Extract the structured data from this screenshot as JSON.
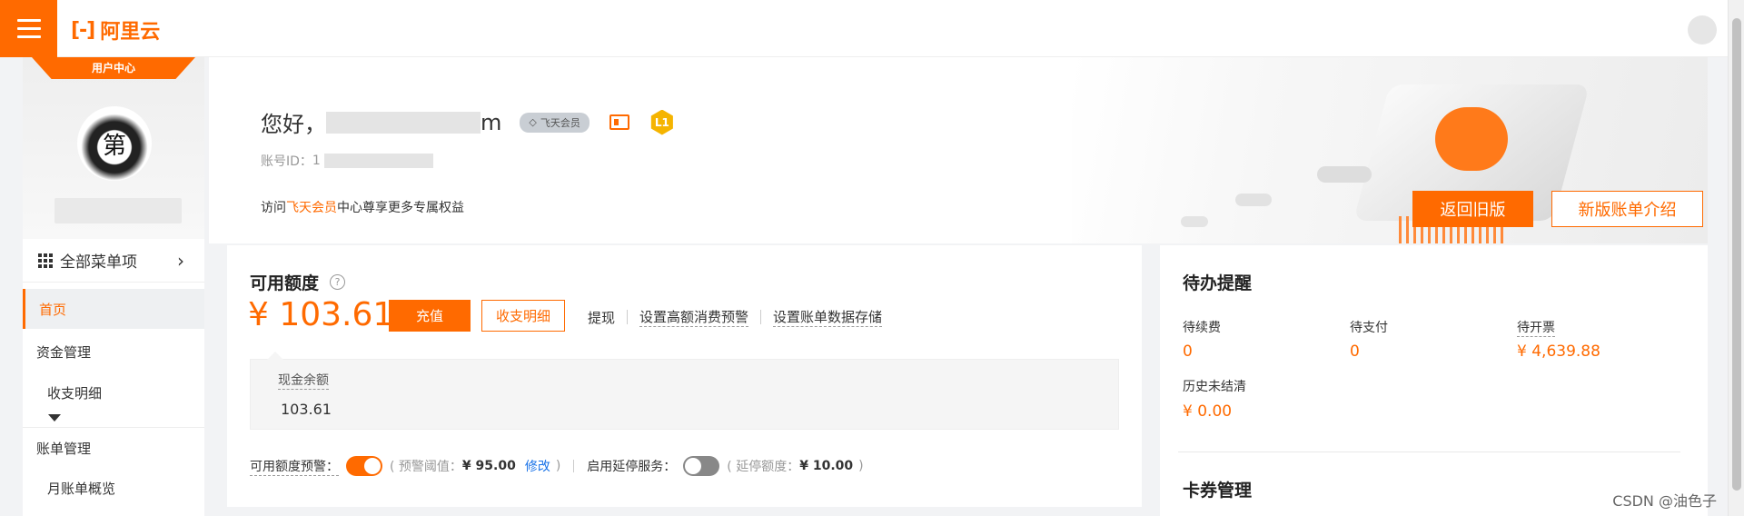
{
  "topbar": {
    "brand": "阿里云",
    "brand_mark": "[-]"
  },
  "sidebar": {
    "banner": "用户中心",
    "avatar_text": "第",
    "all_menu": "全部菜单项",
    "items": [
      {
        "label": "首页"
      },
      {
        "label": "资金管理"
      },
      {
        "label": "收支明细"
      },
      {
        "label": "账单管理"
      },
      {
        "label": "月账单概览"
      }
    ]
  },
  "hero": {
    "greeting": "您好，",
    "username_suffix": "m",
    "member_badge": "飞天会员",
    "level": "L1",
    "account_id_label": "账号ID：",
    "account_id_prefix": "1",
    "visit_prefix": "访问",
    "visit_link": "飞天会员",
    "visit_suffix": "中心尊享更多专属权益",
    "btn_back": "返回旧版",
    "btn_intro": "新版账单介绍"
  },
  "credit": {
    "title": "可用额度",
    "help": "?",
    "amount": "¥ 103.61",
    "recharge": "充值",
    "detail": "收支明细",
    "links": [
      "提现",
      "设置高额消费预警",
      "设置账单数据存储"
    ],
    "cash_label": "现金余额",
    "cash_value": "103.61",
    "alert_label": "可用额度预警：",
    "alert_threshold_label": "( 预警阈值：",
    "alert_threshold_value": "¥ 95.00",
    "alert_modify": "修改",
    "alert_close": ")",
    "delay_label": "启用延停服务：",
    "delay_amount_label": "( 延停额度：",
    "delay_amount_value": "¥ 10.00",
    "delay_close": ")"
  },
  "todo": {
    "title": "待办提醒",
    "items": [
      {
        "label": "待续费",
        "value": "0"
      },
      {
        "label": "待支付",
        "value": "0"
      },
      {
        "label": "待开票",
        "value": "¥ 4,639.88"
      },
      {
        "label": "历史未结清",
        "value": "¥ 0.00"
      }
    ],
    "coupon_title": "卡券管理"
  },
  "watermark": "CSDN @油色子",
  "colors": {
    "accent": "#ff6a00",
    "link": "#1a73e8"
  }
}
